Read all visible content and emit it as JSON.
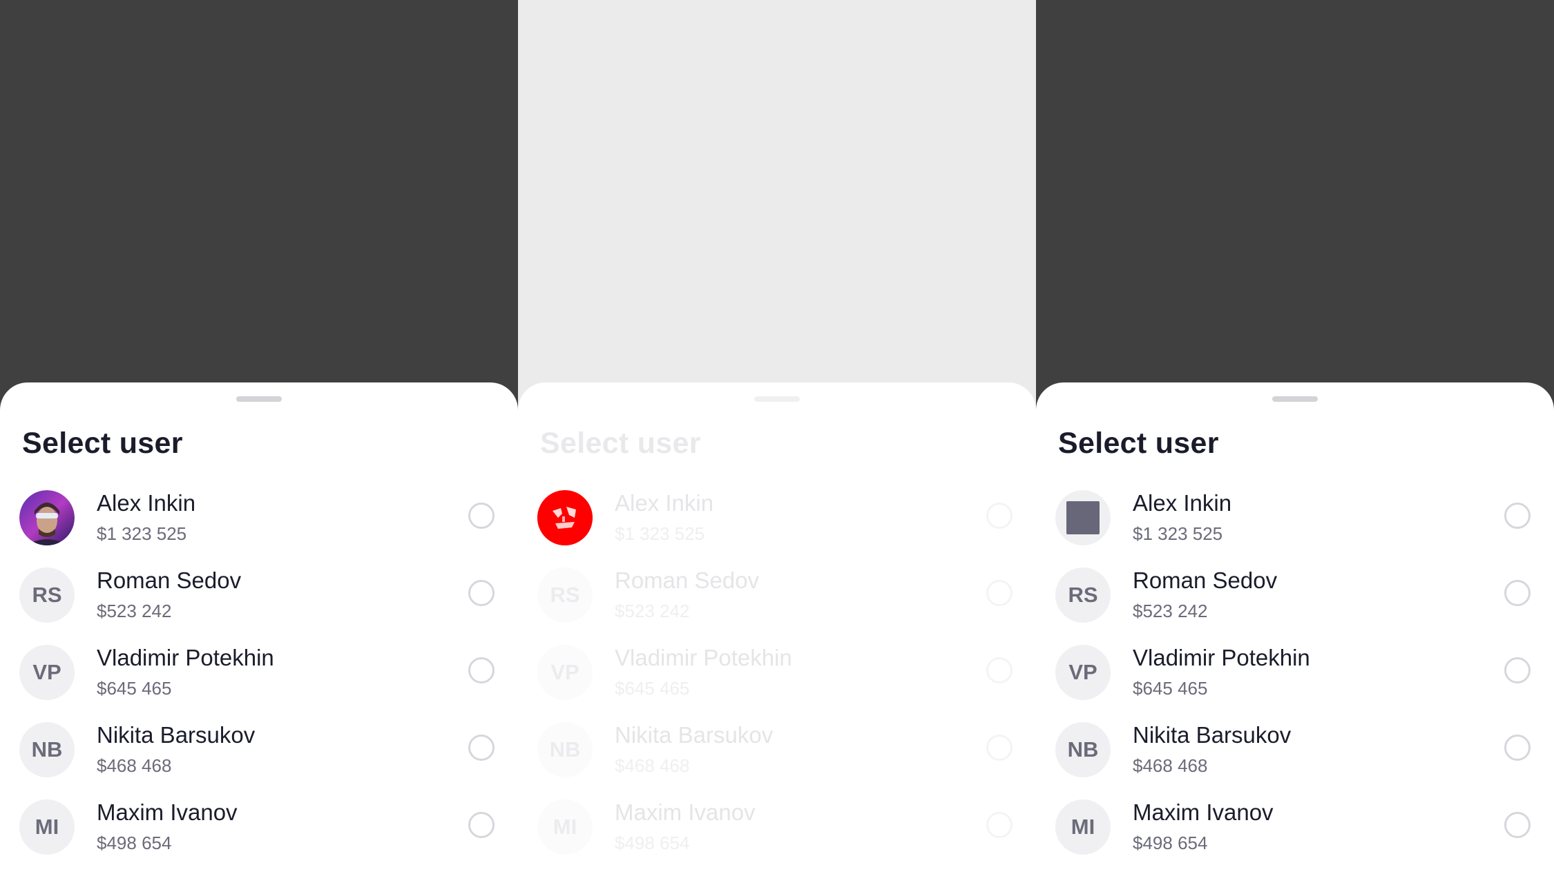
{
  "sheet": {
    "title": "Select user"
  },
  "users": [
    {
      "name": "Alex Inkin",
      "amount": "$1 323 525",
      "initials": ""
    },
    {
      "name": "Roman Sedov",
      "amount": "$523 242",
      "initials": "RS"
    },
    {
      "name": "Vladimir Potekhin",
      "amount": "$645 465",
      "initials": "VP"
    },
    {
      "name": "Nikita Barsukov",
      "amount": "$468 468",
      "initials": "NB"
    },
    {
      "name": "Maxim Ivanov",
      "amount": "$498 654",
      "initials": "MI"
    }
  ],
  "colors": {
    "backdrop_dark": "#404040",
    "backdrop_light": "#ebebeb",
    "text_primary": "#1a1c2b",
    "text_secondary": "#6b6b7a",
    "avatar_bg": "#f0f0f2",
    "placeholder_square": "#676779",
    "avatar_loading": "#ff0000"
  }
}
